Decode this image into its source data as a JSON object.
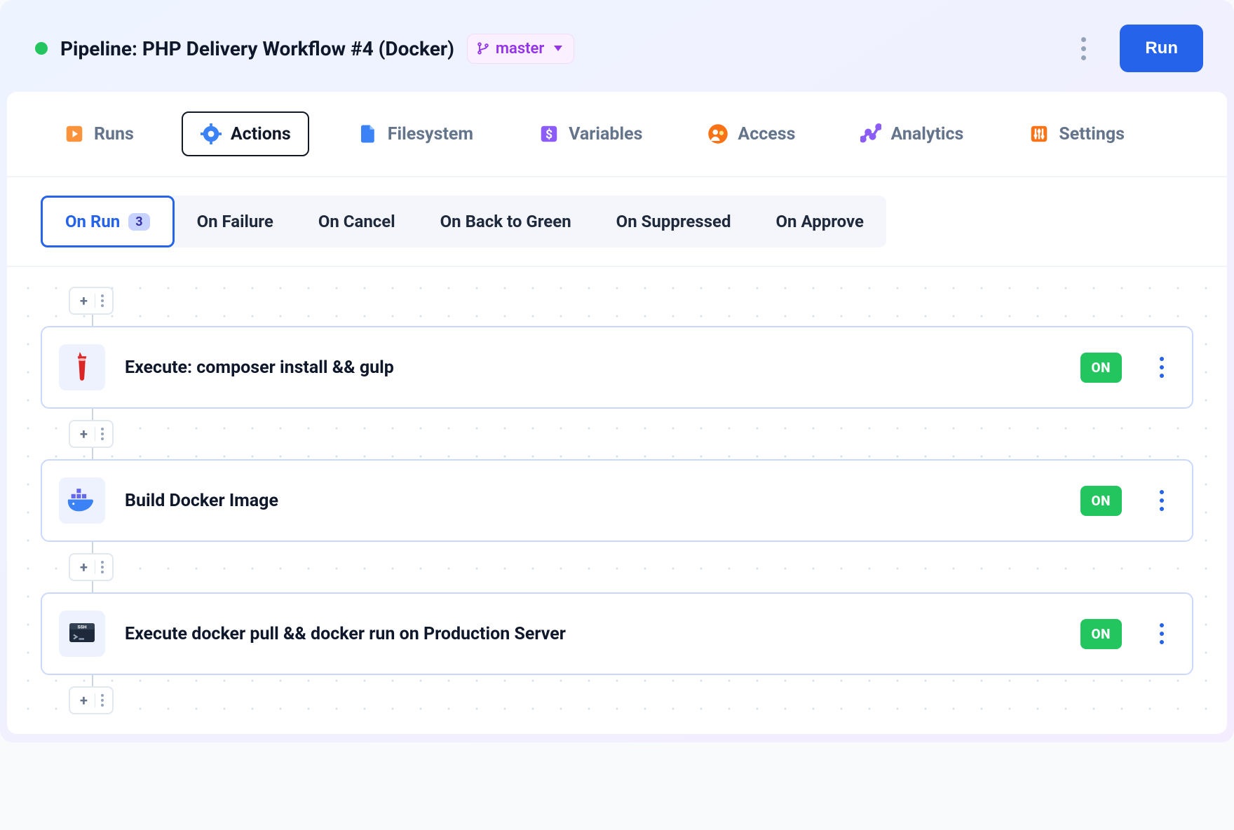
{
  "header": {
    "title": "Pipeline: PHP Delivery Workflow #4 (Docker)",
    "branch": "master",
    "run_label": "Run"
  },
  "tabs": [
    {
      "id": "runs",
      "label": "Runs",
      "icon": "runs"
    },
    {
      "id": "actions",
      "label": "Actions",
      "icon": "actions",
      "active": true
    },
    {
      "id": "filesystem",
      "label": "Filesystem",
      "icon": "filesystem"
    },
    {
      "id": "variables",
      "label": "Variables",
      "icon": "variables"
    },
    {
      "id": "access",
      "label": "Access",
      "icon": "access"
    },
    {
      "id": "analytics",
      "label": "Analytics",
      "icon": "analytics"
    },
    {
      "id": "settings",
      "label": "Settings",
      "icon": "settings"
    }
  ],
  "subtabs": [
    {
      "id": "on-run",
      "label": "On Run",
      "count": "3",
      "active": true
    },
    {
      "id": "on-failure",
      "label": "On Failure"
    },
    {
      "id": "on-cancel",
      "label": "On Cancel"
    },
    {
      "id": "on-back-to-green",
      "label": "On Back to Green"
    },
    {
      "id": "on-suppressed",
      "label": "On Suppressed"
    },
    {
      "id": "on-approve",
      "label": "On Approve"
    }
  ],
  "actions": [
    {
      "icon": "gulp",
      "title": "Execute: composer install && gulp",
      "status": "ON"
    },
    {
      "icon": "docker",
      "title": "Build Docker Image",
      "status": "ON"
    },
    {
      "icon": "ssh",
      "title": "Execute docker pull && docker run on Production Server",
      "status": "ON"
    }
  ]
}
